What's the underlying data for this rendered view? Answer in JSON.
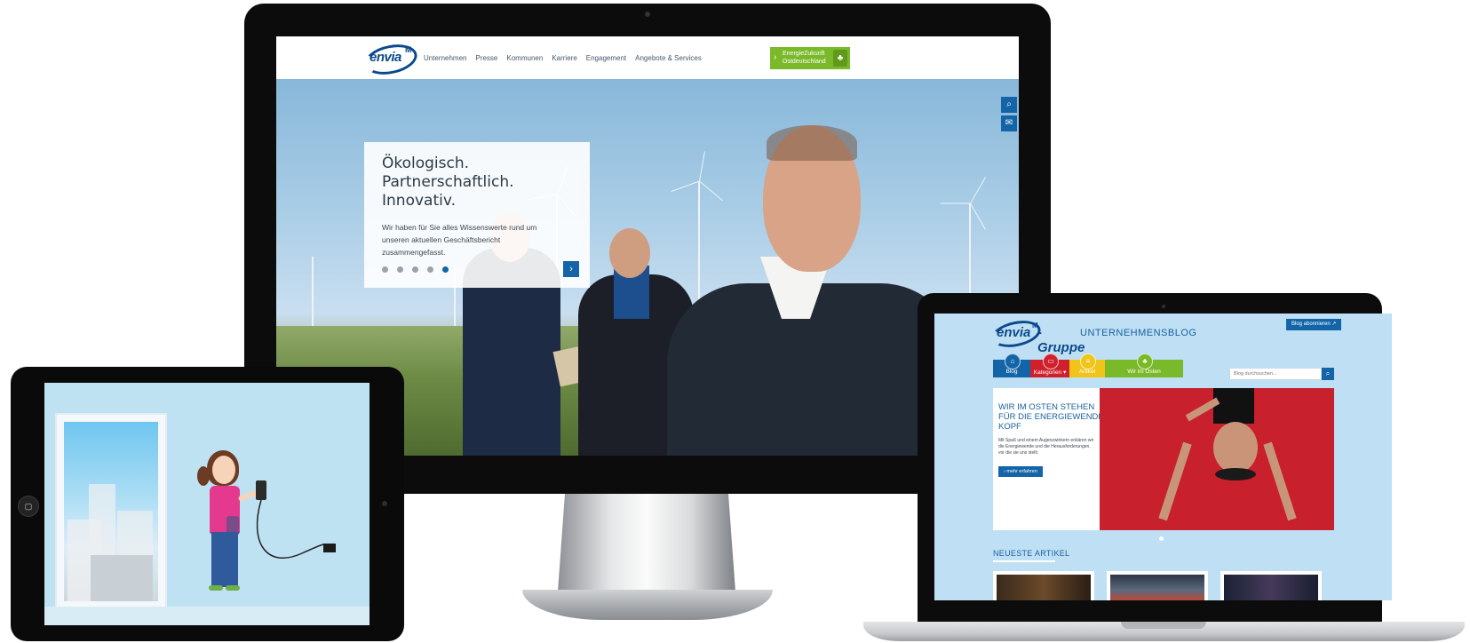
{
  "desktop": {
    "logo_text": "envia",
    "logo_superscript": "M",
    "nav": [
      "Unternehmen",
      "Presse",
      "Kommunen",
      "Karriere",
      "Engagement",
      "Angebote & Services"
    ],
    "energy_button": {
      "line1": "EnergieZukunft",
      "line2": "Ostdeutschland"
    },
    "hero_title": "Ökologisch.\nPartnerschaftlich.\nInnovativ.",
    "hero_text": "Wir haben für Sie alles Wissenswerte rund um unseren aktuellen Geschäftsbericht zusammengefasst.",
    "slides": 5,
    "active_slide": 5,
    "accent_color": "#1365a8",
    "green_color": "#7ab929"
  },
  "laptop": {
    "logo_text": "envia",
    "logo_superscript": "M",
    "logo_suffix": "-Gruppe",
    "blog_label": "UNTERNEHMENSBLOG",
    "subscribe_button": "Blog abonnieren",
    "nav": [
      {
        "label": "Blog",
        "color": "#1365a8",
        "icon": "home-icon"
      },
      {
        "label": "Kategorien ▾",
        "color": "#d0202e",
        "icon": "folder-icon"
      },
      {
        "label": "Artikel",
        "color": "#f0c419",
        "icon": "document-icon"
      },
      {
        "label": "Wir im Osten",
        "color": "#7ab929",
        "icon": "leaf-icon"
      }
    ],
    "search_placeholder": "Blog durchsuchen...",
    "teaser_title": "WIR IM OSTEN STEHEN\nFÜR DIE ENERGIEWENDE\nKOPF",
    "teaser_text": "Mit Spaß und einem Augenzwinkern erklären wir die Energiewende und die Herausforderungen, vor die sie uns stellt.",
    "teaser_button": "mehr erfahren",
    "latest_heading": "NEUESTE ARTIKEL",
    "red_color": "#c8202c"
  }
}
